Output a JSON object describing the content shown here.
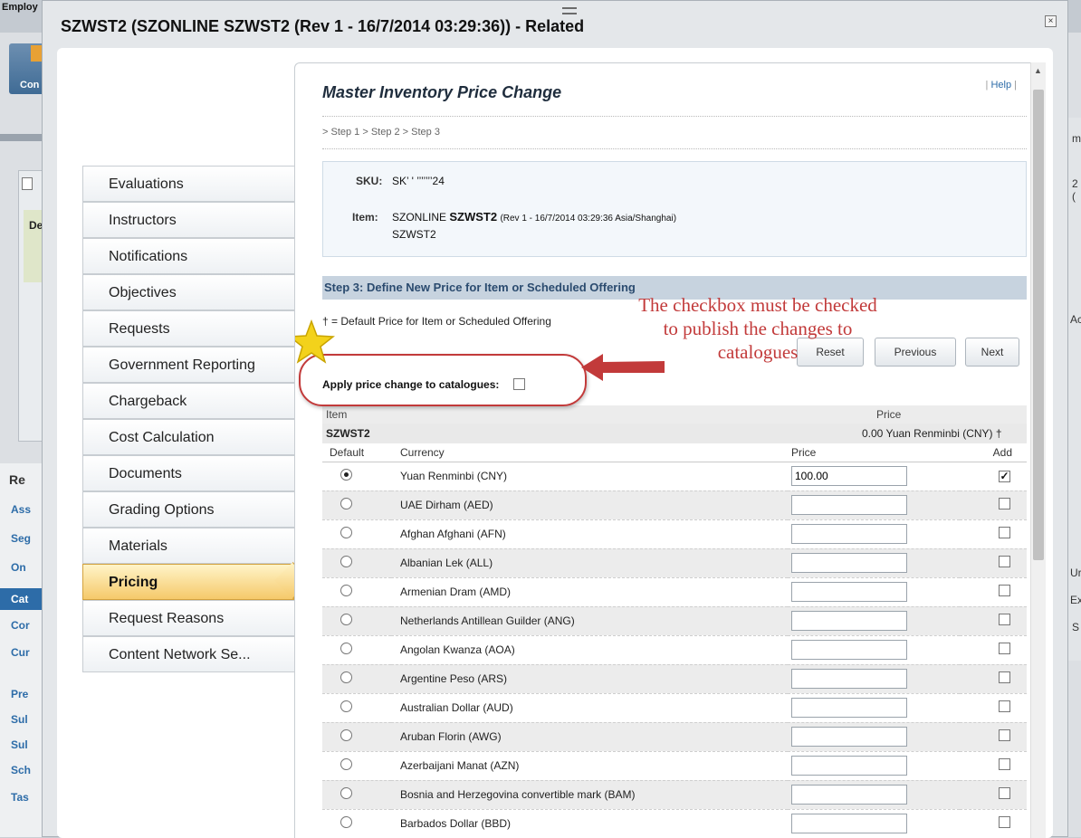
{
  "background": {
    "top_tab": "Employ",
    "tile_label": "Con",
    "panel_initials": "De",
    "nav_title": "Re",
    "nav_items": [
      "Ass",
      "Seg",
      "On",
      "Cat",
      "Cor",
      "Cur",
      "Pre",
      "Sul",
      "Sul",
      "Sch",
      "Tas"
    ],
    "right_texts": [
      "m",
      "2 (",
      "Ac",
      "Ur",
      "Ex",
      "S"
    ]
  },
  "modal": {
    "title": "SZWST2 (SZONLINE SZWST2 (Rev 1 - 16/7/2014 03:29:36)) - Related",
    "close_icon": "×"
  },
  "side_tabs": [
    {
      "label": "Evaluations"
    },
    {
      "label": "Instructors"
    },
    {
      "label": "Notifications"
    },
    {
      "label": "Objectives"
    },
    {
      "label": "Requests"
    },
    {
      "label": "Government Reporting"
    },
    {
      "label": "Chargeback"
    },
    {
      "label": "Cost Calculation"
    },
    {
      "label": "Documents"
    },
    {
      "label": "Grading Options"
    },
    {
      "label": "Materials"
    },
    {
      "label": "Pricing",
      "active": true
    },
    {
      "label": "Request Reasons"
    },
    {
      "label": "Content Network Se..."
    }
  ],
  "content": {
    "help": "Help",
    "title": "Master Inventory Price Change",
    "steps": "> Step 1 > Step 2 > Step 3",
    "sku_label": "SKU:",
    "sku_value": "SK’ ' ’’’’’’’24",
    "item_label": "Item:",
    "item_prefix": "SZONLINE",
    "item_bold": "SZWST2",
    "item_rev": "(Rev 1 - 16/7/2014 03:29:36 Asia/Shanghai)",
    "item_line2": "SZWST2",
    "section": "Step 3: Define New Price for Item or Scheduled Offering",
    "default_note": "†  = Default Price for Item or Scheduled Offering",
    "buttons": {
      "reset": "Reset",
      "previous": "Previous",
      "next": "Next"
    },
    "apply_label": "Apply price change to catalogues:",
    "callout": "The checkbox must be checked to publish the changes to catalogues"
  },
  "table": {
    "header": {
      "item": "Item",
      "price": "Price"
    },
    "item_row": {
      "name": "SZWST2",
      "price": "0.00 Yuan Renminbi (CNY) †"
    },
    "columns": {
      "default": "Default",
      "currency": "Currency",
      "price": "Price",
      "add": "Add"
    },
    "rows": [
      {
        "currency": "Yuan Renminbi (CNY)",
        "price": "100.00",
        "default": true,
        "add": true
      },
      {
        "currency": "UAE Dirham (AED)",
        "price": "",
        "default": false,
        "add": false
      },
      {
        "currency": "Afghan Afghani (AFN)",
        "price": "",
        "default": false,
        "add": false
      },
      {
        "currency": "Albanian Lek (ALL)",
        "price": "",
        "default": false,
        "add": false
      },
      {
        "currency": "Armenian Dram (AMD)",
        "price": "",
        "default": false,
        "add": false
      },
      {
        "currency": "Netherlands Antillean Guilder (ANG)",
        "price": "",
        "default": false,
        "add": false
      },
      {
        "currency": "Angolan Kwanza (AOA)",
        "price": "",
        "default": false,
        "add": false
      },
      {
        "currency": "Argentine Peso (ARS)",
        "price": "",
        "default": false,
        "add": false
      },
      {
        "currency": "Australian Dollar (AUD)",
        "price": "",
        "default": false,
        "add": false
      },
      {
        "currency": "Aruban Florin (AWG)",
        "price": "",
        "default": false,
        "add": false
      },
      {
        "currency": "Azerbaijani Manat (AZN)",
        "price": "",
        "default": false,
        "add": false
      },
      {
        "currency": "Bosnia and Herzegovina convertible mark (BAM)",
        "price": "",
        "default": false,
        "add": false
      },
      {
        "currency": "Barbados Dollar (BBD)",
        "price": "",
        "default": false,
        "add": false
      }
    ]
  },
  "colors": {
    "accent_red": "#c23a3a",
    "active_tab": "#f5c96a",
    "section_bar": "#c7d3df",
    "link": "#2d6ca8"
  },
  "icons": {
    "star": "star-icon",
    "arrow": "arrow-left-icon",
    "close": "close-icon"
  }
}
